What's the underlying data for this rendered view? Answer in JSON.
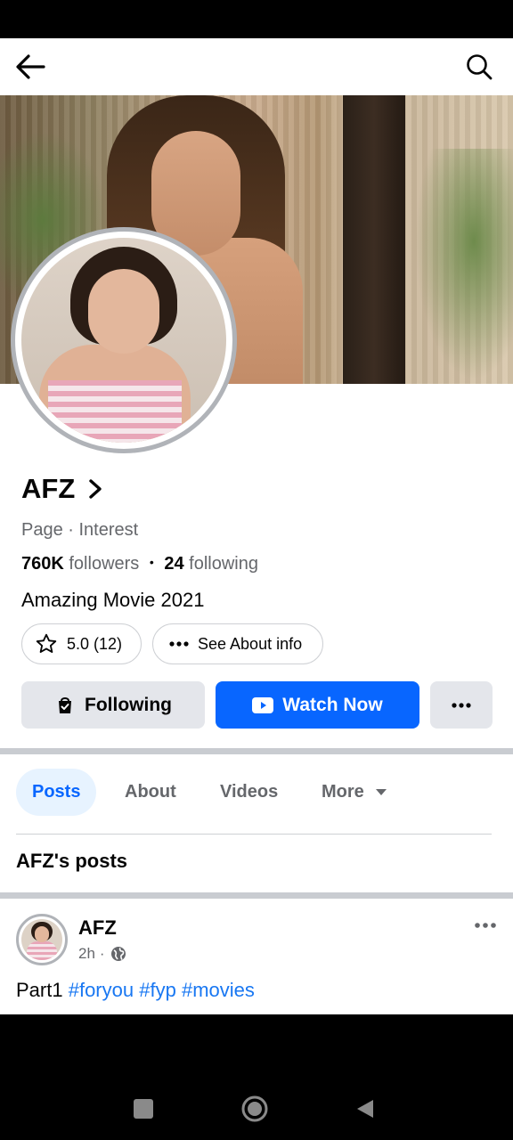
{
  "header": {
    "back_icon": "arrow-left-icon",
    "search_icon": "search-icon"
  },
  "profile": {
    "name": "AFZ",
    "category": "Page · Interest",
    "followers_count": "760K",
    "followers_label": "followers",
    "separator": "•",
    "following_count": "24",
    "following_label": "following",
    "bio": "Amazing Movie 2021",
    "rating": "5.0 (12)",
    "about_label": "See About info"
  },
  "actions": {
    "following_label": "Following",
    "watch_label": "Watch Now"
  },
  "tabs": [
    {
      "label": "Posts",
      "active": true
    },
    {
      "label": "About",
      "active": false
    },
    {
      "label": "Videos",
      "active": false
    },
    {
      "label": "More",
      "active": false
    }
  ],
  "posts_section": {
    "title": "AFZ's posts"
  },
  "post": {
    "author": "AFZ",
    "time": "2h",
    "meta_separator": "·",
    "text_prefix": "Part1",
    "hashtags": [
      "#foryou",
      "#fyp",
      "#movies"
    ]
  },
  "colors": {
    "accent": "#0866ff",
    "link": "#1877f2",
    "secondary_text": "#65676b",
    "button_gray": "#e4e6eb"
  }
}
